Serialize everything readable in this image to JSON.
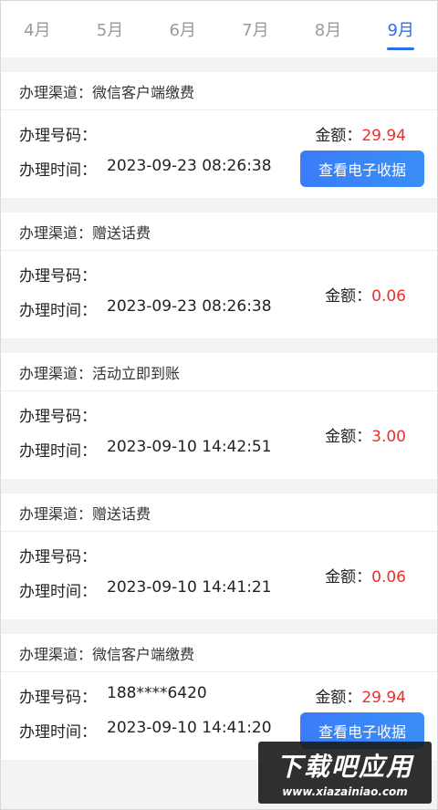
{
  "tabs": [
    {
      "label": "4月"
    },
    {
      "label": "5月"
    },
    {
      "label": "6月"
    },
    {
      "label": "7月"
    },
    {
      "label": "8月"
    },
    {
      "label": "9月",
      "active": true
    }
  ],
  "labels": {
    "channel": "办理渠道：",
    "number": "办理号码：",
    "time": "办理时间：",
    "amount": "金额：",
    "receipt_button": "查看电子收据"
  },
  "records": [
    {
      "channel": "微信客户端缴费",
      "number": "",
      "time": "2023-09-23 08:26:38",
      "amount": "29.94"
    },
    {
      "channel": "赠送话费",
      "number": "",
      "time": "2023-09-23 08:26:38",
      "amount": "0.06"
    },
    {
      "channel": "活动立即到账",
      "number": "",
      "time": "2023-09-10 14:42:51",
      "amount": "3.00"
    },
    {
      "channel": "赠送话费",
      "number": "",
      "time": "2023-09-10 14:41:21",
      "amount": "0.06"
    },
    {
      "channel": "微信客户端缴费",
      "number": "188****6420",
      "time": "2023-09-10 14:41:20",
      "amount": "29.94"
    }
  ],
  "watermark": {
    "title": "下载吧应用",
    "url": "www.xiazainiao.com"
  },
  "colors": {
    "accent": "#2f6df0",
    "amount": "#e5322d"
  }
}
